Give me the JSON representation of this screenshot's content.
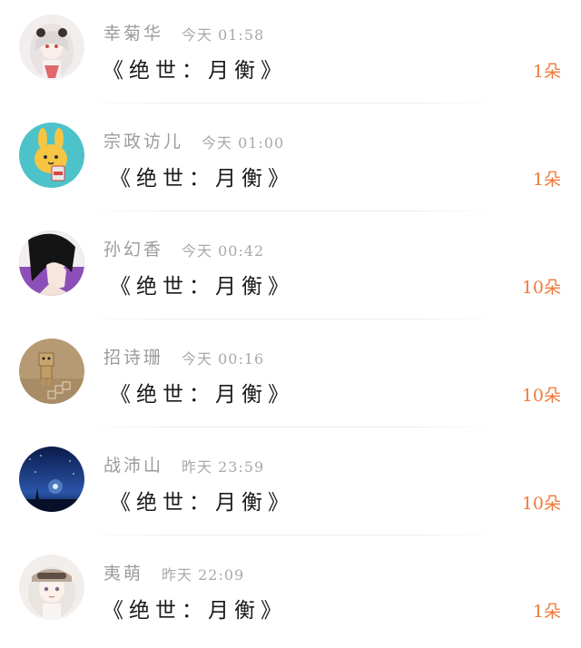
{
  "gifts": [
    {
      "name": "幸菊华",
      "time": "今天 01:58",
      "message": "《绝世：月衡》",
      "count": "1朵",
      "avatar": "anime-girl-white-hair-avatar"
    },
    {
      "name": "宗政访儿",
      "time": "今天 01:00",
      "message": "《绝世：月衡》",
      "count": "1朵",
      "avatar": "cartoon-bunny-avatar"
    },
    {
      "name": "孙幻香",
      "time": "今天 00:42",
      "message": "《绝世：月衡》",
      "count": "10朵",
      "avatar": "anime-boy-dark-hair-avatar"
    },
    {
      "name": "招诗珊",
      "time": "今天 00:16",
      "message": "《绝世：月衡》",
      "count": "10朵",
      "avatar": "cardboard-robot-avatar"
    },
    {
      "name": "战沛山",
      "time": "昨天 23:59",
      "message": "《绝世：月衡》",
      "count": "10朵",
      "avatar": "starry-night-avatar"
    },
    {
      "name": "夷萌",
      "time": "昨天 22:09",
      "message": "《绝世：月衡》",
      "count": "1朵",
      "avatar": "anime-girl-goggles-avatar"
    }
  ],
  "colors": {
    "name": "#9b9b9b",
    "time": "#a9a9a9",
    "message": "#1a1a1a",
    "count": "#f07a3a"
  }
}
